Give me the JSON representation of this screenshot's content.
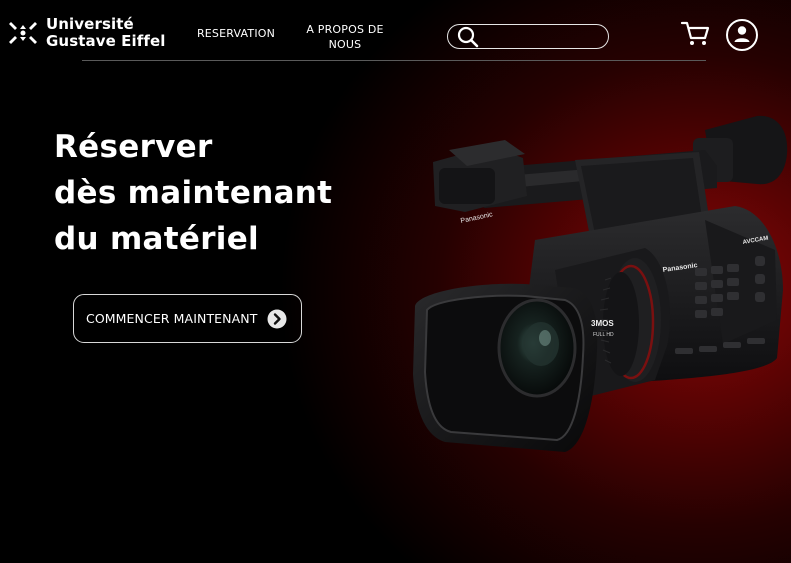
{
  "brand": {
    "line1": "Université",
    "line2": "Gustave Eiffel"
  },
  "nav": {
    "reservation": "RESERVATION",
    "about_line1": "A PROPOS DE",
    "about_line2": "NOUS"
  },
  "search": {
    "value": "",
    "placeholder": ""
  },
  "hero": {
    "line1": "Réserver",
    "line2": "dès maintenant",
    "line3": "du matériel",
    "cta_label": "COMMENCER MAINTENANT"
  },
  "camera_labels": {
    "brand_top": "Panasonic",
    "brand_side": "Panasonic",
    "avccam": "AVCCAM",
    "sensor": "3MOS",
    "fullhd": "FULL HD"
  },
  "colors": {
    "accent_red": "#8a0606",
    "background": "#000000",
    "text": "#ffffff"
  },
  "icons": [
    "logo-icon",
    "search-icon",
    "cart-icon",
    "user-icon",
    "arrow-right-icon"
  ]
}
